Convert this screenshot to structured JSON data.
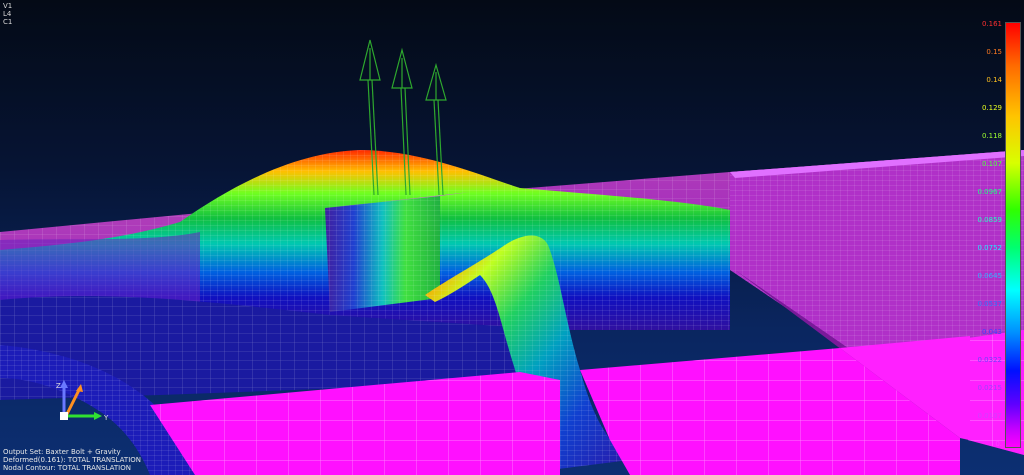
{
  "view_info": {
    "view": "V1",
    "layer": "L4",
    "color_layer": "C1"
  },
  "output_info": {
    "output_set": "Output Set: Baxter Bolt + Gravity",
    "deformed": "Deformed(0.161): TOTAL TRANSLATION",
    "nodal_contour": "Nodal Contour: TOTAL TRANSLATION"
  },
  "legend": {
    "values": [
      {
        "label": "0.161",
        "color": "#ff3030"
      },
      {
        "label": "0.15",
        "color": "#ff7a20"
      },
      {
        "label": "0.14",
        "color": "#ffc020"
      },
      {
        "label": "0.129",
        "color": "#e8ff20"
      },
      {
        "label": "0.118",
        "color": "#a0ff30"
      },
      {
        "label": "0.107",
        "color": "#50ff40"
      },
      {
        "label": "0.0967",
        "color": "#20ff80"
      },
      {
        "label": "0.0859",
        "color": "#20ffc0"
      },
      {
        "label": "0.0752",
        "color": "#20e8ff"
      },
      {
        "label": "0.0645",
        "color": "#30b0ff"
      },
      {
        "label": "0.0537",
        "color": "#3070ff"
      },
      {
        "label": "0.043",
        "color": "#4040ff"
      },
      {
        "label": "0.0322",
        "color": "#7040ff"
      },
      {
        "label": "0.0215",
        "color": "#a040ff"
      },
      {
        "label": "0.0107",
        "color": "#d040ff"
      },
      {
        "label": "0.",
        "color": "#ff40ff"
      }
    ]
  },
  "triad": {
    "x_label": "Y",
    "y_label": "Z"
  },
  "colors": {
    "background_top": "#040a16",
    "background_bottom": "#0c2f72",
    "mesh_low": "#ff00ff",
    "mesh_high": "#ff0000",
    "mesh_lines": "#ffffff",
    "load_arrows": "#2ea82e"
  },
  "icons": {
    "triad": "coordinate-triad-icon",
    "load_arrow": "force-arrow-icon"
  }
}
